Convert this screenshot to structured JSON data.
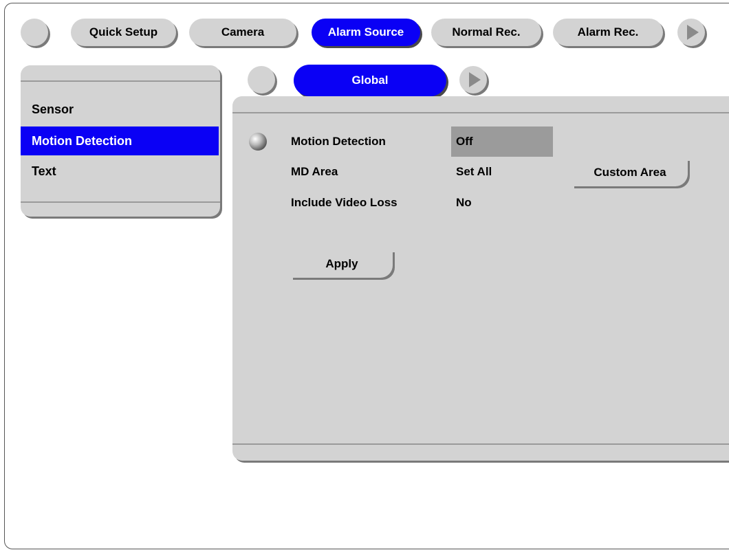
{
  "top_tabs": {
    "items": [
      {
        "label": "Quick Setup",
        "active": false
      },
      {
        "label": "Camera",
        "active": false
      },
      {
        "label": "Alarm Source",
        "active": true
      },
      {
        "label": "Normal Rec.",
        "active": false
      },
      {
        "label": "Alarm Rec.",
        "active": false
      }
    ]
  },
  "sub_tabs": {
    "items": [
      {
        "label": "Global",
        "active": true
      }
    ]
  },
  "sidebar": {
    "items": [
      {
        "label": "Sensor",
        "selected": false
      },
      {
        "label": "Motion Detection",
        "selected": true
      },
      {
        "label": "Text",
        "selected": false
      }
    ]
  },
  "settings": {
    "motion_detection": {
      "label": "Motion Detection",
      "value": "Off"
    },
    "md_area": {
      "label": "MD Area",
      "value": "Set All",
      "button": "Custom Area"
    },
    "include_video_loss": {
      "label": "Include Video Loss",
      "value": "No"
    }
  },
  "actions": {
    "apply_label": "Apply"
  },
  "colors": {
    "accent": "#0a00f5",
    "panel": "#d3d3d3",
    "highlight": "#9b9b9b"
  }
}
